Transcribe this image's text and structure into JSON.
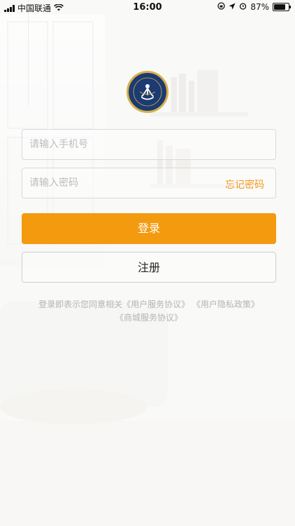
{
  "status_bar": {
    "carrier": "中国联通",
    "time": "16:00",
    "battery": "87%",
    "battery_level": 0.87
  },
  "login": {
    "phone_placeholder": "请输入手机号",
    "password_placeholder": "请输入密码",
    "forgot_label": "忘记密码",
    "login_label": "登录",
    "register_label": "注册"
  },
  "agreement": {
    "prefix": "登录即表示您同意相关",
    "user_service": "《用户服务协议》",
    "privacy": "《用户隐私政策》",
    "mall_service": "《商城服务协议》"
  },
  "colors": {
    "accent": "#f39a0f",
    "logo_bg": "#1c3b72",
    "logo_ring": "#d8b04a"
  }
}
